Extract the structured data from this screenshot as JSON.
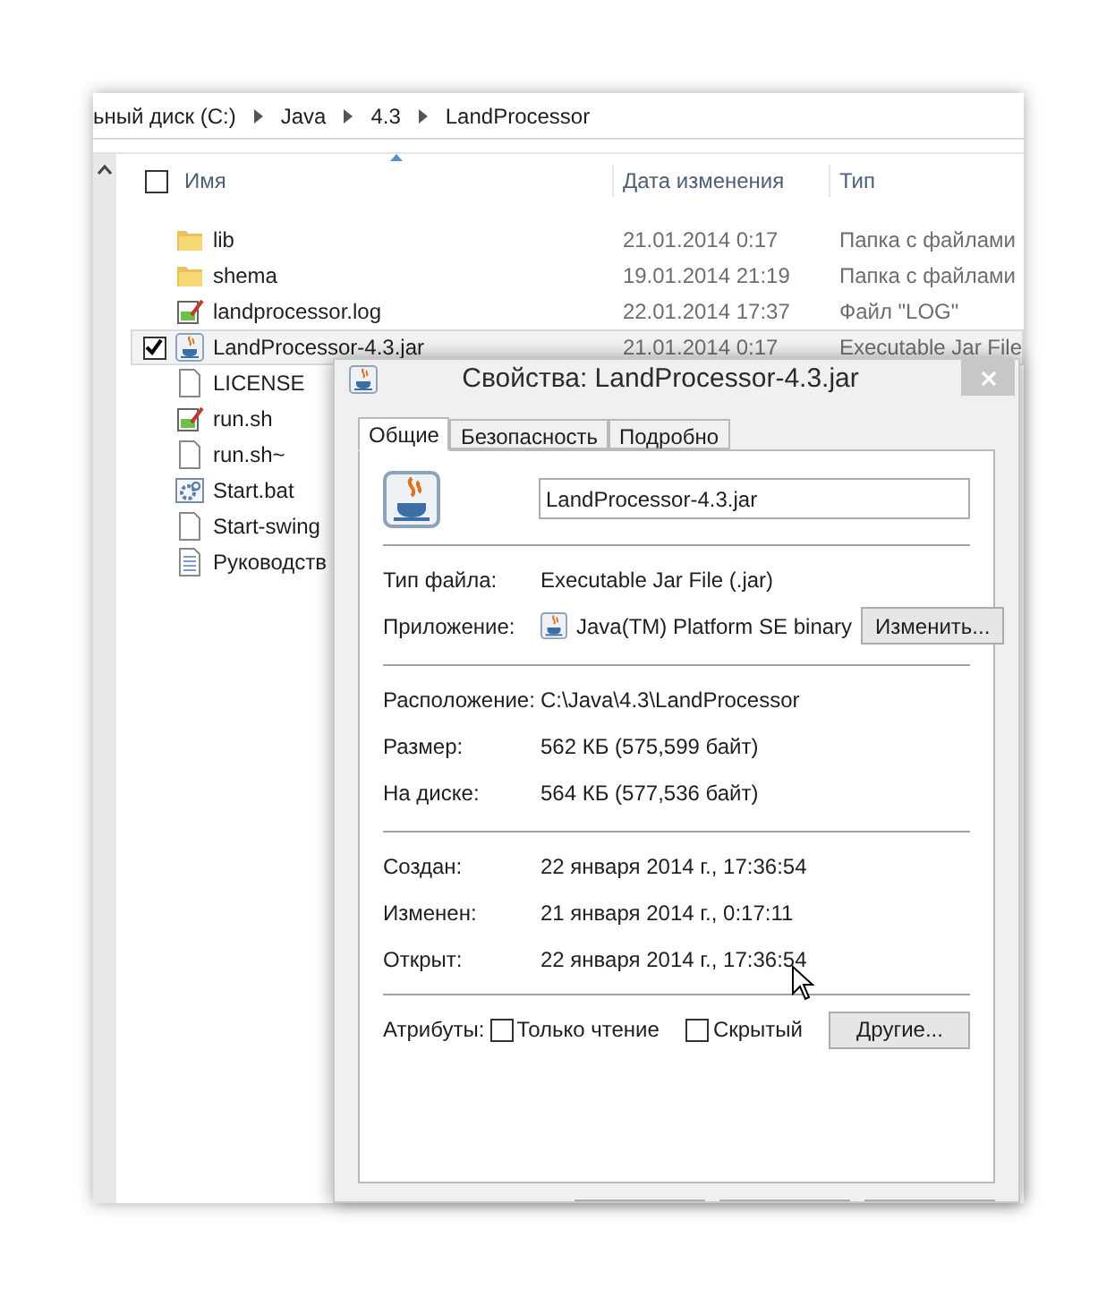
{
  "explorer": {
    "breadcrumb": [
      "ьный диск (C:)",
      "Java",
      "4.3",
      "LandProcessor"
    ],
    "header": {
      "checked": false,
      "columns": [
        "Имя",
        "Дата изменения",
        "Тип"
      ]
    },
    "rows": [
      {
        "name": "lib",
        "kind": "folder",
        "date": "21.01.2014 0:17",
        "type": "Папка с файлами",
        "selected": false
      },
      {
        "name": "shema",
        "kind": "folder",
        "date": "19.01.2014 21:19",
        "type": "Папка с файлами",
        "selected": false
      },
      {
        "name": "landprocessor.log",
        "kind": "log",
        "date": "22.01.2014 17:37",
        "type": "Файл \"LOG\"",
        "selected": false
      },
      {
        "name": "LandProcessor-4.3.jar",
        "kind": "jar",
        "date": "21.01.2014 0:17",
        "type": "Executable Jar File",
        "selected": true
      },
      {
        "name": "LICENSE",
        "kind": "file",
        "selected": false
      },
      {
        "name": "run.sh",
        "kind": "log",
        "selected": false
      },
      {
        "name": "run.sh~",
        "kind": "file",
        "selected": false
      },
      {
        "name": "Start.bat",
        "kind": "bat",
        "selected": false
      },
      {
        "name": "Start-swing",
        "kind": "file",
        "selected": false
      },
      {
        "name": "Руководств",
        "kind": "doc",
        "selected": false
      }
    ]
  },
  "dialog": {
    "title": "Свойства: LandProcessor-4.3.jar",
    "tabs": [
      {
        "label": "Общие",
        "selected": true
      },
      {
        "label": "Безопасность",
        "selected": false
      },
      {
        "label": "Подробно",
        "selected": false
      }
    ],
    "file_name": "LandProcessor-4.3.jar",
    "sections": [
      [
        {
          "kind": "text",
          "label": "Тип файла:",
          "value": "Executable Jar File (.jar)"
        },
        {
          "kind": "app",
          "label": "Приложение:",
          "value": "Java(TM) Platform SE binary",
          "button": "Изменить..."
        }
      ],
      [
        {
          "kind": "text",
          "label": "Расположение:",
          "value": "C:\\Java\\4.3\\LandProcessor"
        },
        {
          "kind": "text",
          "label": "Размер:",
          "value": "562 КБ (575,599 байт)"
        },
        {
          "kind": "text",
          "label": "На диске:",
          "value": "564 КБ (577,536 байт)"
        }
      ],
      [
        {
          "kind": "text",
          "label": "Создан:",
          "value": "22 января 2014 г., 17:36:54"
        },
        {
          "kind": "text",
          "label": "Изменен:",
          "value": "21 января 2014 г., 0:17:11"
        },
        {
          "kind": "text",
          "label": "Открыт:",
          "value": "22 января 2014 г., 17:36:54"
        }
      ]
    ],
    "attributes_label": "Атрибуты:",
    "attributes": [
      {
        "label": "Только чтение",
        "checked": false
      },
      {
        "label": "Скрытый",
        "checked": false
      }
    ],
    "more_button": "Другие..."
  }
}
